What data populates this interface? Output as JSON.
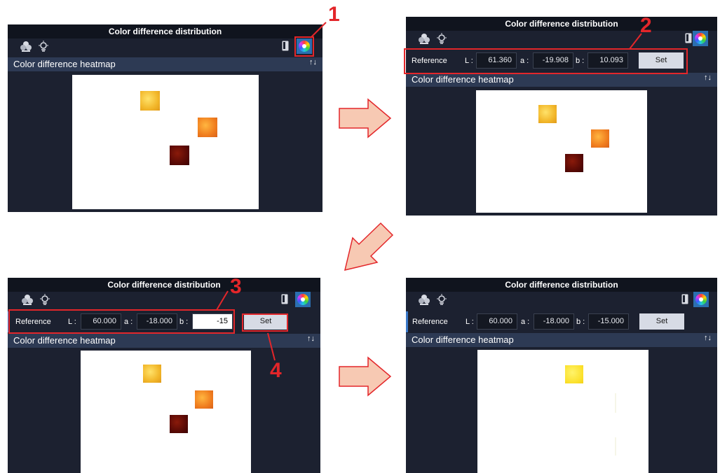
{
  "panel_title": "Color difference distribution",
  "heatmap_header": "Color difference heatmap",
  "reference_label": "Reference",
  "axis_labels": {
    "L": "L :",
    "a": "a :",
    "b": "b :"
  },
  "set_label": "Set",
  "step_numbers": [
    "1",
    "2",
    "3",
    "4"
  ],
  "steps": [
    {
      "id": "step1",
      "show_reference": false
    },
    {
      "id": "step2",
      "show_reference": true,
      "L": "61.360",
      "a": "-19.908",
      "b": "10.093"
    },
    {
      "id": "step3",
      "show_reference": true,
      "L": "60.000",
      "a": "-18.000",
      "b": "-15",
      "b_field_active": true
    },
    {
      "id": "step4",
      "show_reference": true,
      "L": "60.000",
      "a": "-18.000",
      "b": "-15.000"
    }
  ],
  "colors": {
    "panel_bg": "#1c2130",
    "title_bg": "#10141e",
    "header_bg": "#2d3a54",
    "accent": "#2b6fb0",
    "annotation_red": "#e3262a",
    "arrow_fill": "#f7c9b3",
    "arrow_stroke": "#e3262a"
  },
  "icons": [
    "add-light-icon",
    "bulb-icon",
    "device-icon",
    "color-wheel-icon",
    "sort-arrows-icon",
    "flow-arrow"
  ]
}
